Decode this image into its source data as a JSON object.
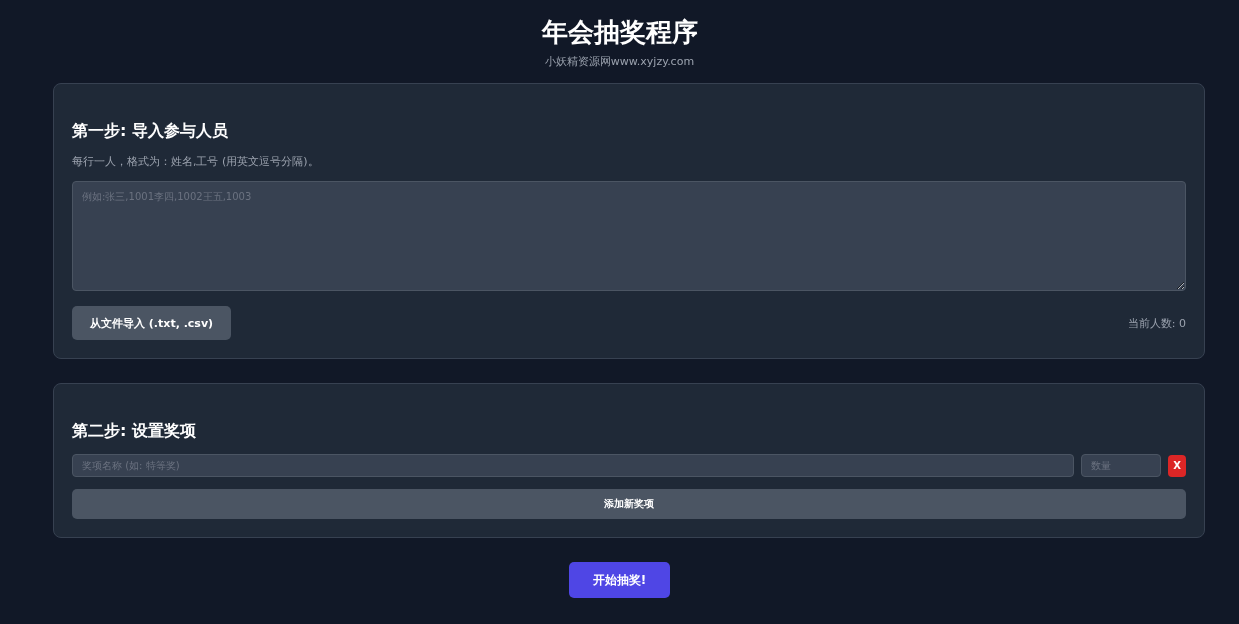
{
  "header": {
    "title": "年会抽奖程序",
    "subtitle": "小妖精资源网www.xyjzy.com"
  },
  "step1": {
    "heading": "第一步: 导入参与人员",
    "hint": "每行一人，格式为：姓名,工号 (用英文逗号分隔)。",
    "textarea": {
      "placeholder": "例如:张三,1001李四,1002王五,1003"
    },
    "import_button": "从文件导入 (.txt, .csv)",
    "count": "当前人数: 0"
  },
  "step2": {
    "heading": "第二步: 设置奖项",
    "prizes": [
      {
        "name_placeholder": "奖项名称 (如: 特等奖)",
        "quantity_placeholder": "数量",
        "remove": "X"
      }
    ],
    "add_button": "添加新奖项"
  },
  "start_button": "开始抽奖!"
}
